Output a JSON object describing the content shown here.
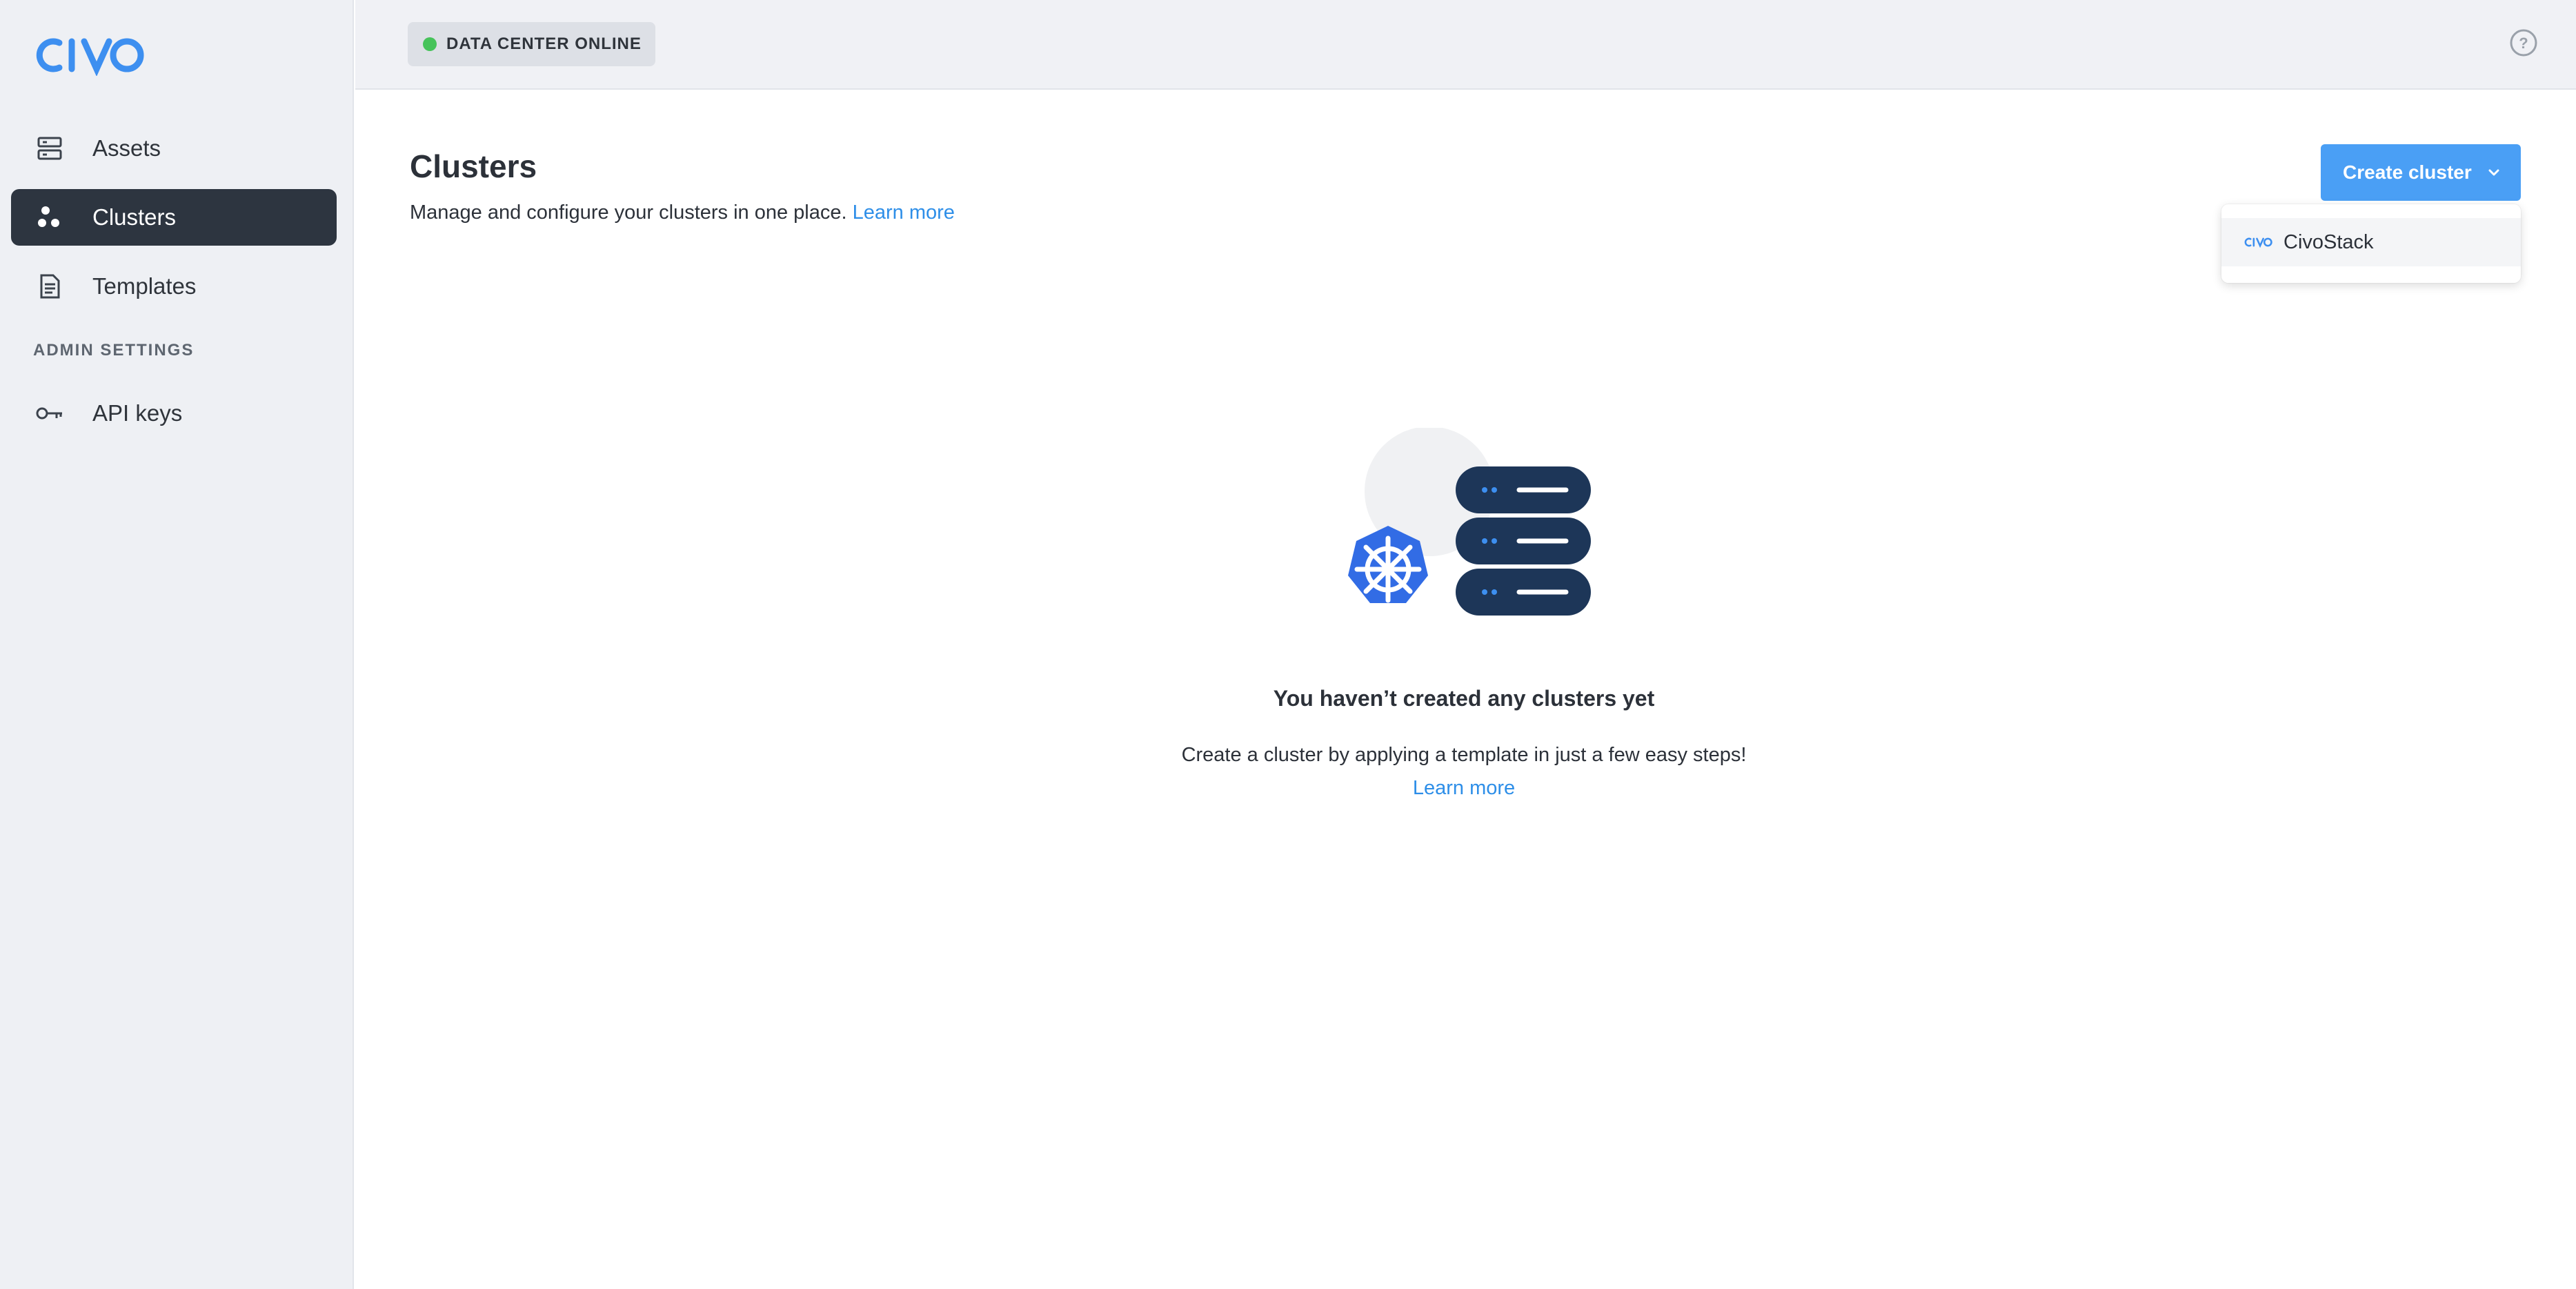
{
  "brand": {
    "logo_text": "CIVO",
    "accent": "#4a9ff5",
    "link_color": "#2d8ee8"
  },
  "sidebar": {
    "items": [
      {
        "label": "Assets",
        "icon": "server-icon",
        "active": false
      },
      {
        "label": "Clusters",
        "icon": "cluster-icon",
        "active": true
      },
      {
        "label": "Templates",
        "icon": "document-icon",
        "active": false
      }
    ],
    "admin_section_label": "ADMIN SETTINGS",
    "admin_items": [
      {
        "label": "API keys",
        "icon": "key-icon",
        "active": false
      }
    ]
  },
  "header": {
    "status_text": "DATA CENTER ONLINE",
    "status_color": "#46c35a",
    "help_icon": "help-icon"
  },
  "main": {
    "title": "Clusters",
    "subtitle": "Manage and configure your clusters in one place.",
    "subtitle_link": "Learn more",
    "create_button_label": "Create cluster",
    "dropdown": {
      "items": [
        {
          "label": "CivoStack",
          "icon": "civo-mini-logo"
        }
      ]
    },
    "empty_state": {
      "title": "You haven’t created any clusters yet",
      "description": "Create a cluster by applying a template in just a few easy steps!",
      "link": "Learn more"
    }
  }
}
